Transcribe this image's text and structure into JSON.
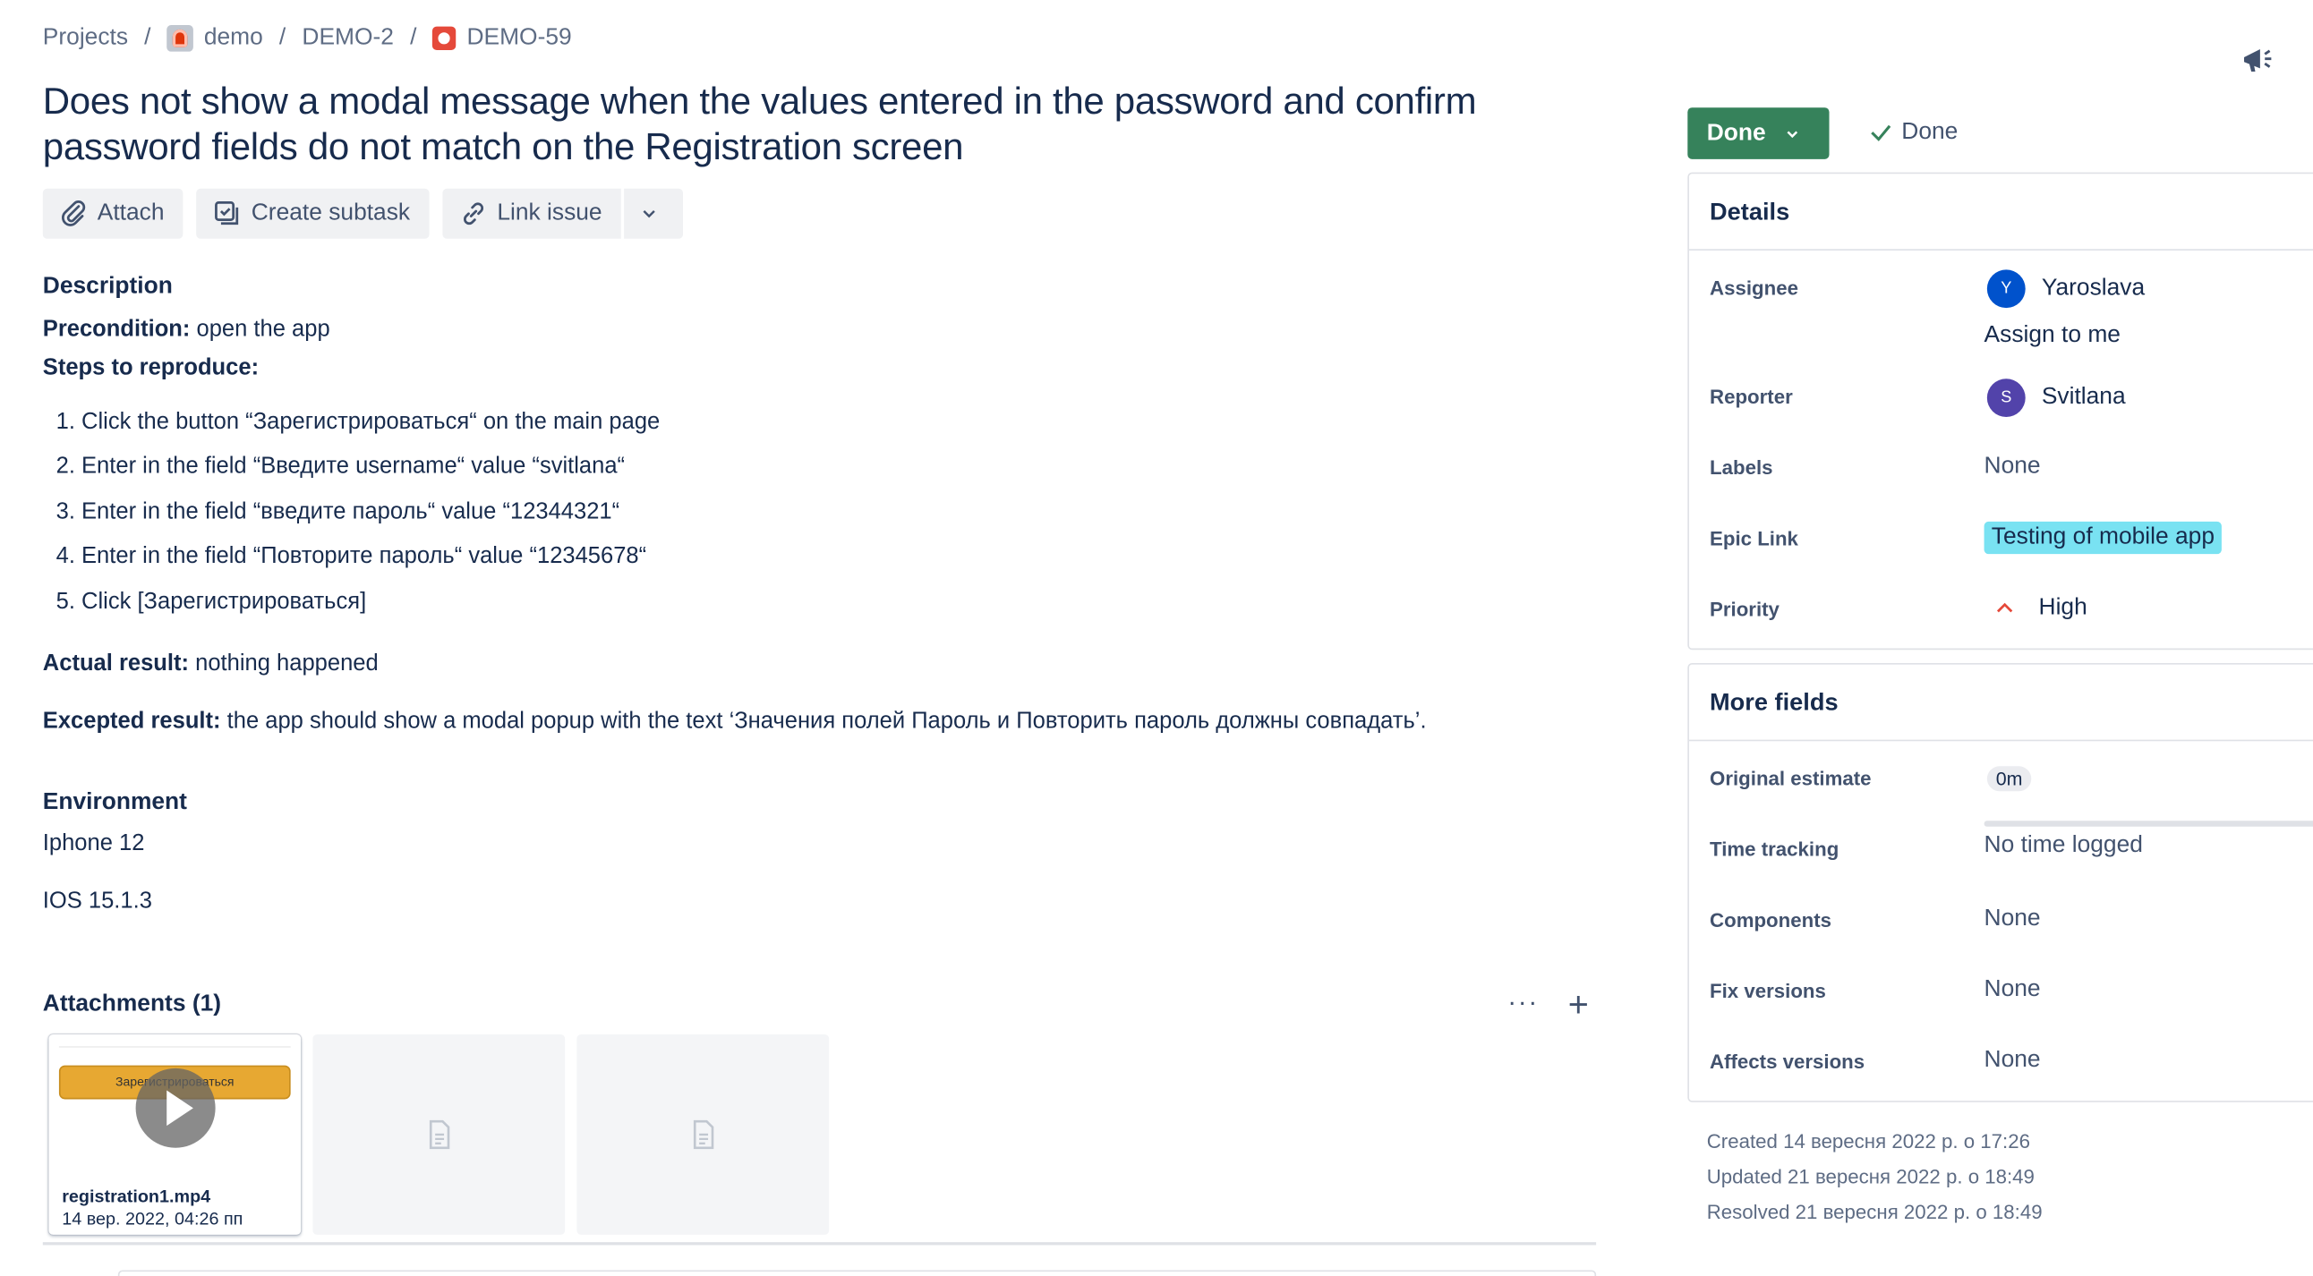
{
  "breadcrumb": {
    "projects": "Projects",
    "project": "demo",
    "parent": "DEMO-2",
    "issue": "DEMO-59",
    "separator": "/"
  },
  "issue": {
    "title": "Does not show a modal message when the values entered in the password and confirm password fields do not match on the Registration screen"
  },
  "actions": {
    "attach": "Attach",
    "create_subtask": "Create subtask",
    "link_issue": "Link issue"
  },
  "description": {
    "heading": "Description",
    "precondition_label": "Precondition:",
    "precondition_text": " open the app",
    "steps_label": "Steps to reproduce:",
    "steps": [
      "1. Click the button “Зарегистрироваться“ on the main page",
      "2. Enter in the field “Введите username“ value “svitlana“",
      "3. Enter in the field “введите пароль“ value “12344321“",
      "4. Enter in the field “Повторите пароль“ value “12345678“",
      "5. Click [Зарегистрироваться]"
    ],
    "actual_label": "Actual result:",
    "actual_text": " nothing happened",
    "expected_label": "Excepted result:",
    "expected_text": " the app should show a modal popup with the text ‘Значения полей Пароль и Повторить пароль должны совпадать’."
  },
  "environment": {
    "heading": "Environment",
    "device": "Iphone 12",
    "os": "IOS 15.1.3"
  },
  "attachments": {
    "heading": "Attachments (1)",
    "more": "···",
    "add": "+",
    "video_button_text": "Зарегистрироваться",
    "file_name": "registration1.mp4",
    "file_date": "14 вер. 2022, 04:26 пп"
  },
  "status": {
    "button": "Done",
    "resolution": "Done"
  },
  "details": {
    "heading": "Details",
    "assignee_label": "Assignee",
    "assignee_initial": "Y",
    "assignee_name": "Yaroslava",
    "assign_to_me": "Assign to me",
    "reporter_label": "Reporter",
    "reporter_initial": "S",
    "reporter_name": "Svitlana",
    "labels_label": "Labels",
    "labels_value": "None",
    "epic_label": "Epic Link",
    "epic_value": "Testing of mobile app",
    "priority_label": "Priority",
    "priority_value": "High"
  },
  "more_fields": {
    "heading": "More fields",
    "estimate_label": "Original estimate",
    "estimate_value": "0m",
    "time_label": "Time tracking",
    "time_value": "No time logged",
    "components_label": "Components",
    "components_value": "None",
    "fix_label": "Fix versions",
    "fix_value": "None",
    "affects_label": "Affects versions",
    "affects_value": "None"
  },
  "meta": {
    "created": "Created 14 вересня 2022 р. о 17:26",
    "updated": "Updated 21 вересня 2022 р. о 18:49",
    "resolved": "Resolved 21 вересня 2022 р. о 18:49"
  },
  "colors": {
    "status_done": "#36825b",
    "epic": "#79e2f2",
    "link": "#0052cc",
    "priority_high": "#e5493a"
  }
}
